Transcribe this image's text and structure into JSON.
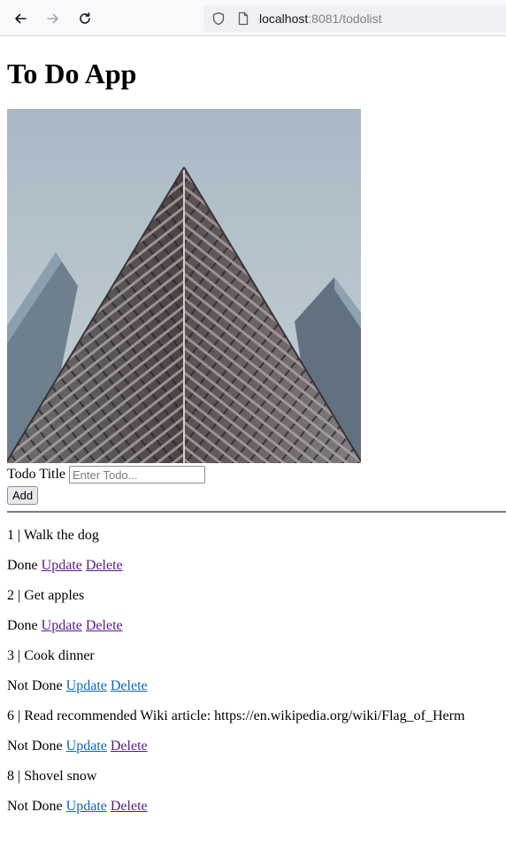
{
  "browser": {
    "url_host": "localhost",
    "url_rest": ":8081/todolist",
    "icons": [
      "back-arrow-icon",
      "forward-arrow-icon",
      "reload-icon",
      "shield-icon",
      "page-icon"
    ]
  },
  "page": {
    "title": "To Do App",
    "hero_image": "building-photo",
    "form": {
      "label": "Todo Title",
      "placeholder": "Enter Todo...",
      "value": "",
      "add_label": "Add"
    },
    "todos": [
      {
        "title": "1 | Walk the dog",
        "status": "Done",
        "update_label": "Update",
        "delete_label": "Delete",
        "update_visited": true,
        "delete_visited": true
      },
      {
        "title": "2 | Get apples",
        "status": "Done",
        "update_label": "Update",
        "delete_label": "Delete",
        "update_visited": true,
        "delete_visited": true
      },
      {
        "title": "3 | Cook dinner",
        "status": "Not Done",
        "update_label": "Update",
        "delete_label": "Delete",
        "update_visited": false,
        "delete_visited": false
      },
      {
        "title": "6 | Read recommended Wiki article: https://en.wikipedia.org/wiki/Flag_of_Herm",
        "status": "Not Done",
        "update_label": "Update",
        "delete_label": "Delete",
        "update_visited": false,
        "delete_visited": true
      },
      {
        "title": "8 | Shovel snow",
        "status": "Not Done",
        "update_label": "Update",
        "delete_label": "Delete",
        "update_visited": false,
        "delete_visited": true
      }
    ]
  },
  "colors": {
    "link_visited": "#551a8b",
    "link_unvisited": "#0b66c3",
    "toolbar_bg": "#f9f9fb",
    "urlbar_bg": "#f0f0f4"
  }
}
